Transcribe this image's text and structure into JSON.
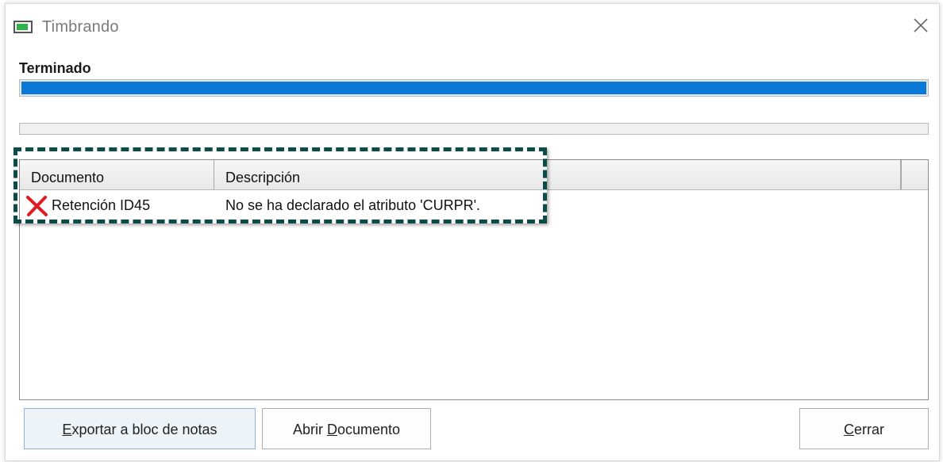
{
  "window": {
    "title": "Timbrando",
    "icon": "app-window-icon",
    "close_icon": "close-icon"
  },
  "status": {
    "label": "Terminado",
    "progress_main": 1.0,
    "progress_secondary": 0.0
  },
  "list": {
    "columns": [
      "Documento",
      "Descripción"
    ],
    "rows": [
      {
        "status_icon": "error-x-icon",
        "documento": "Retención ID45",
        "descripcion": "No se ha declarado el atributo 'CURPR'."
      }
    ]
  },
  "buttons": {
    "export": {
      "pre": "",
      "key": "E",
      "post": "xportar a bloc de notas"
    },
    "open": {
      "pre": "Abrir ",
      "key": "D",
      "post": "ocumento"
    },
    "close": {
      "pre": "",
      "key": "C",
      "post": "errar"
    }
  },
  "colors": {
    "progress_fill": "#0a78d7",
    "highlight_border": "#0d4b48",
    "error_icon": "#e01b24"
  }
}
